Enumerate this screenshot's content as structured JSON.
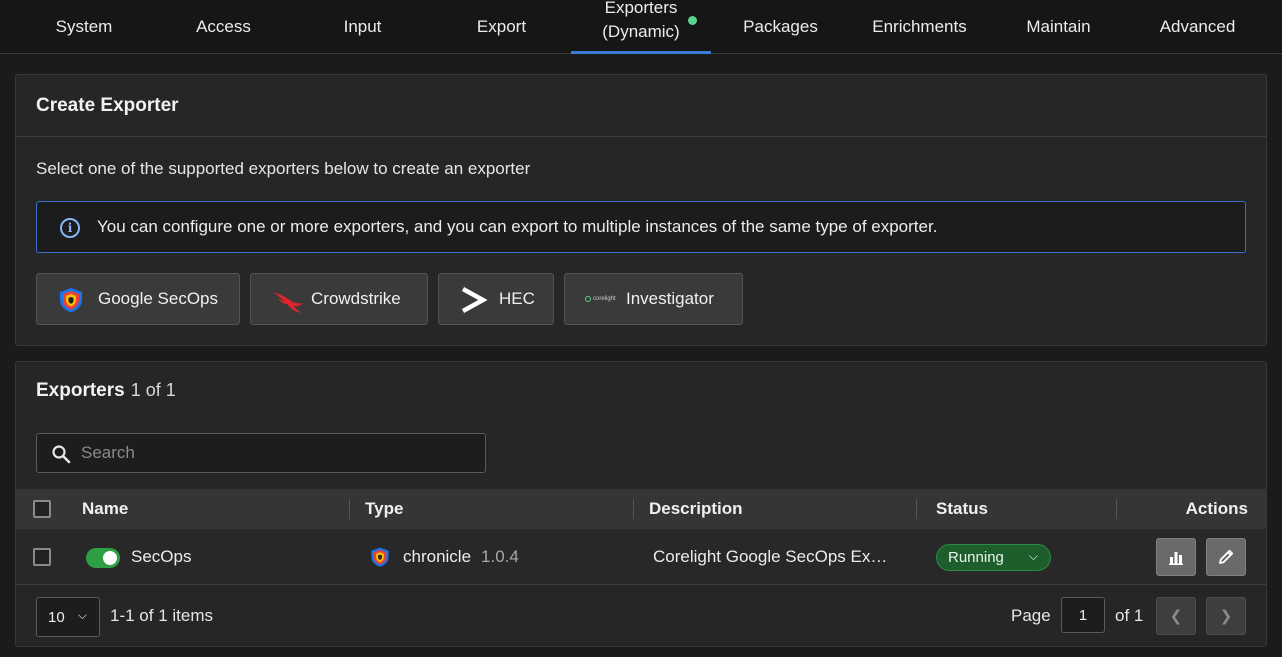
{
  "nav": {
    "tabs": [
      {
        "label": "System"
      },
      {
        "label": "Access"
      },
      {
        "label": "Input"
      },
      {
        "label": "Export"
      },
      {
        "label_line1": "Exporters",
        "label_line2": "(Dynamic)",
        "active": true,
        "status_dot": "#58d68d"
      },
      {
        "label": "Packages"
      },
      {
        "label": "Enrichments"
      },
      {
        "label": "Maintain"
      },
      {
        "label": "Advanced"
      }
    ]
  },
  "create": {
    "title": "Create Exporter",
    "subtitle": "Select one of the supported exporters below to create an exporter",
    "info": "You can configure one or more exporters, and you can export to multiple instances of the same type of exporter.",
    "options": [
      {
        "label": "Google SecOps",
        "icon": "google-secops-shield-icon"
      },
      {
        "label": "Crowdstrike",
        "icon": "crowdstrike-falcon-icon"
      },
      {
        "label": "HEC",
        "icon": "hec-chevron-icon"
      },
      {
        "label": "Investigator",
        "icon": "corelight-logo-icon",
        "logo_text": "corelight"
      }
    ]
  },
  "exporters": {
    "title": "Exporters",
    "count": "1 of 1",
    "search_placeholder": "Search",
    "columns": {
      "name": "Name",
      "type": "Type",
      "description": "Description",
      "status": "Status",
      "actions": "Actions"
    },
    "rows": [
      {
        "enabled": true,
        "name": "SecOps",
        "type": "chronicle",
        "version": "1.0.4",
        "description": "Corelight Google SecOps Ex…",
        "status": "Running"
      }
    ]
  },
  "pagination": {
    "per_page": "10",
    "items_text": "1-1 of 1 items",
    "page_label": "Page",
    "page": "1",
    "of_text": "of 1"
  },
  "colors": {
    "accent": "#3a7bd5",
    "running": "#1e5d2c",
    "toggle_on": "#2ea043"
  }
}
